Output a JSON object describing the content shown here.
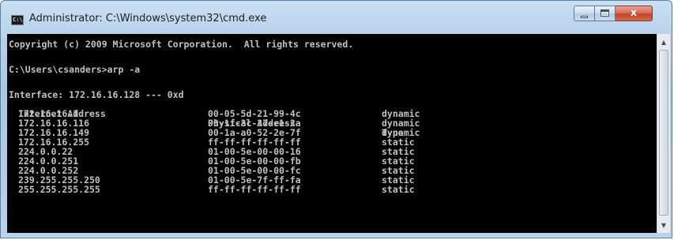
{
  "window": {
    "title": "Administrator: C:\\Windows\\system32\\cmd.exe",
    "icon": "cmd-icon",
    "icon_text": "C:\\"
  },
  "buttons": {
    "minimize": "minimize-icon",
    "maximize": "maximize-icon",
    "close": "x"
  },
  "console": {
    "copyright": "Copyright (c) 2009 Microsoft Corporation.  All rights reserved.",
    "prompt": "C:\\Users\\csanders>arp -a",
    "interface": "Interface: 172.16.16.128 --- 0xd",
    "headers": {
      "address": "Internet Address",
      "physical": "Physical Address",
      "type": "Type"
    },
    "rows": [
      {
        "address": "172.16.16.1",
        "physical": "00-05-5d-21-99-4c",
        "type": "dynamic"
      },
      {
        "address": "172.16.16.116",
        "physical": "00-1f-3c-37-e1-2a",
        "type": "dynamic"
      },
      {
        "address": "172.16.16.149",
        "physical": "00-1a-a0-52-2e-7f",
        "type": "dynamic"
      },
      {
        "address": "172.16.16.255",
        "physical": "ff-ff-ff-ff-ff-ff",
        "type": "static"
      },
      {
        "address": "224.0.0.22",
        "physical": "01-00-5e-00-00-16",
        "type": "static"
      },
      {
        "address": "224.0.0.251",
        "physical": "01-00-5e-00-00-fb",
        "type": "static"
      },
      {
        "address": "224.0.0.252",
        "physical": "01-00-5e-00-00-fc",
        "type": "static"
      },
      {
        "address": "239.255.255.250",
        "physical": "01-00-5e-7f-ff-fa",
        "type": "static"
      },
      {
        "address": "255.255.255.255",
        "physical": "ff-ff-ff-ff-ff-ff",
        "type": "static"
      }
    ],
    "text_color": "#c0c0c0",
    "background": "#000000"
  }
}
